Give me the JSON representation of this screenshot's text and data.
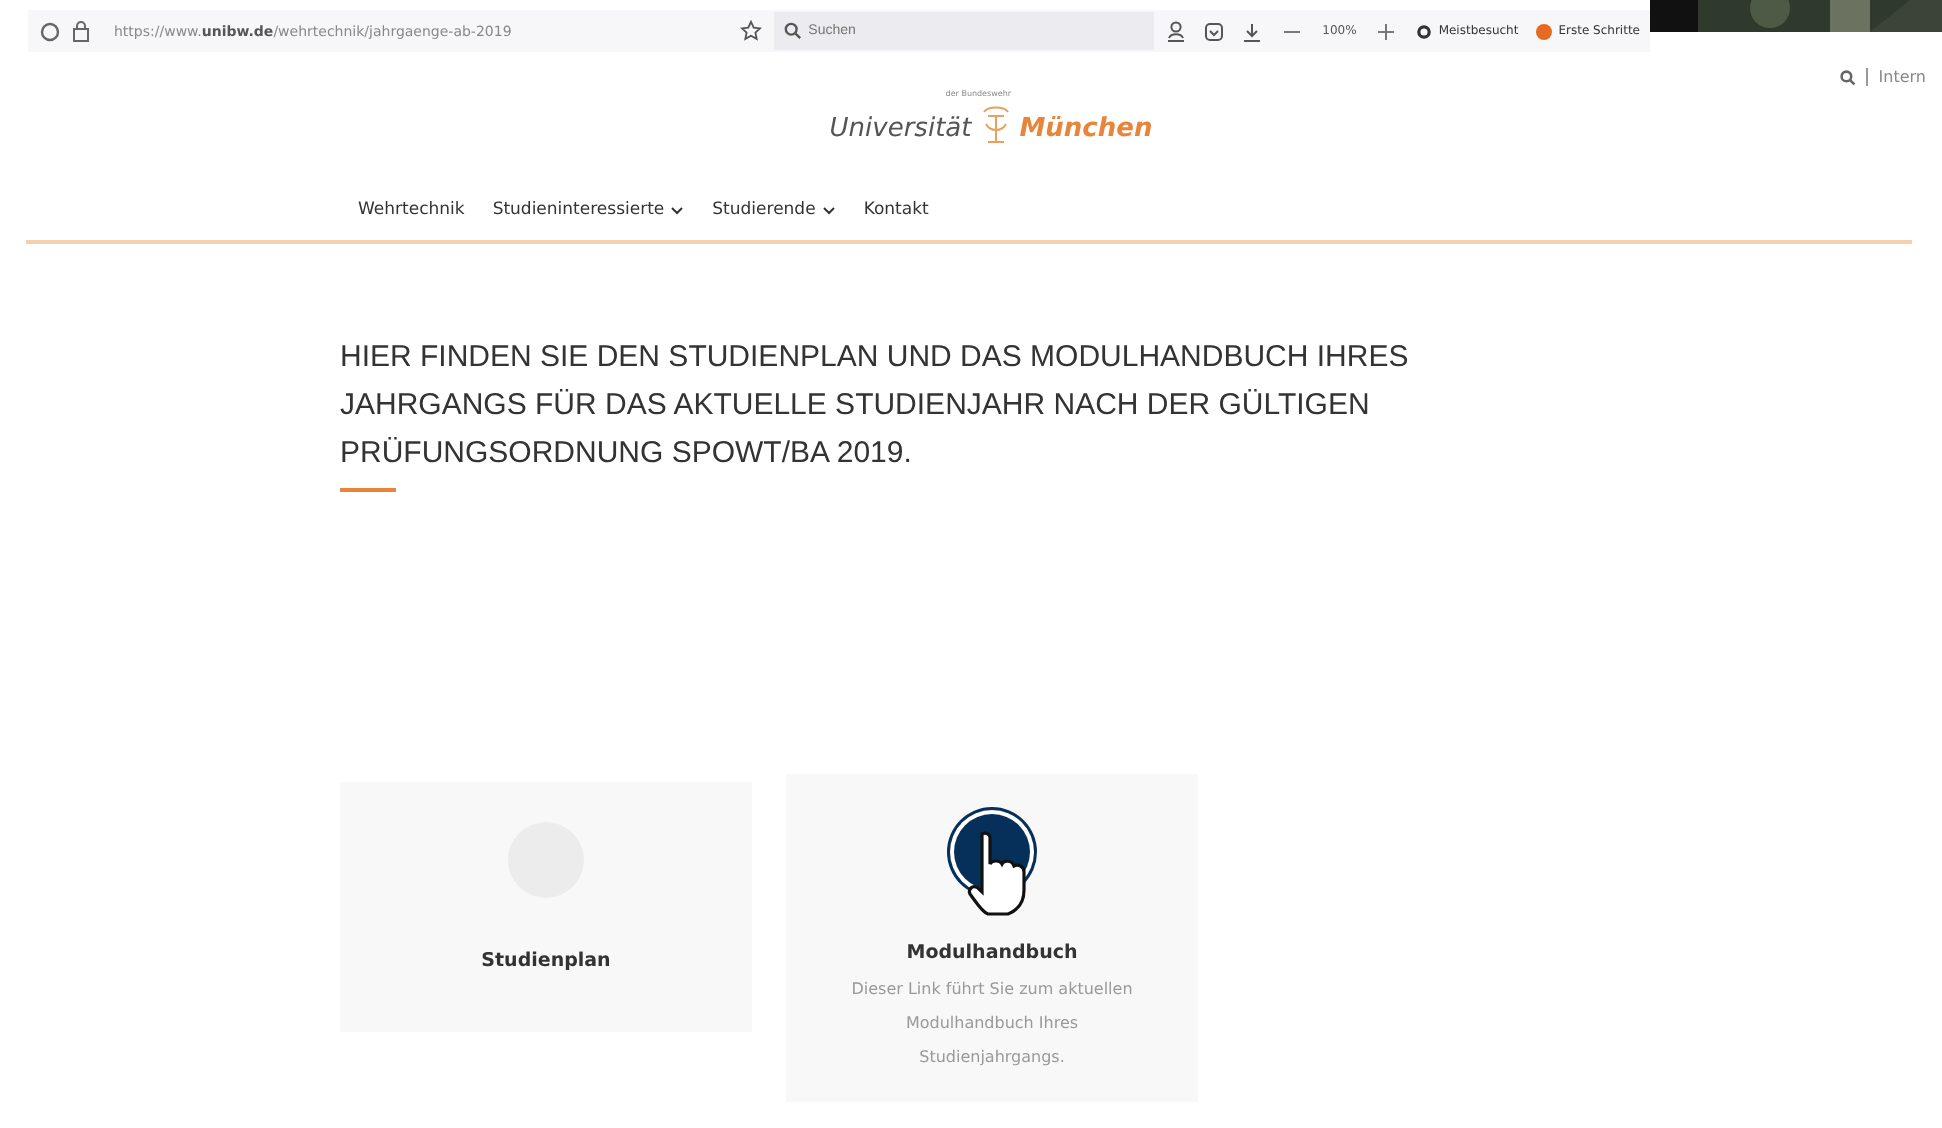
{
  "browser": {
    "url_prefix": "https://www.",
    "url_domain": "unibw.de",
    "url_path": "/wehrtechnik/jahrgaenge-ab-2019",
    "search_placeholder": "Suchen",
    "zoom": "100%",
    "bookmarks": [
      "Meistbesucht",
      "Erste Schritte"
    ]
  },
  "site": {
    "logo_small": "der Bundeswehr",
    "logo_left": "Universität",
    "logo_right": "München",
    "search_link": "Intern",
    "nav": [
      {
        "label": "Wehrtechnik",
        "dropdown": false
      },
      {
        "label": "Studieninteressierte",
        "dropdown": true
      },
      {
        "label": "Studierende",
        "dropdown": true
      },
      {
        "label": "Kontakt",
        "dropdown": false
      }
    ]
  },
  "heading": "HIER FINDEN SIE DEN STUDIENPLAN UND DAS MODULHANDBUCH IHRES JAHRGANGS FÜR DAS AKTUELLE STUDIENJAHR NACH DER GÜLTIGEN PRÜFUNGSORDNUNG SPOWT/BA 2019.",
  "cards": [
    {
      "title": "Studienplan",
      "hovered": false
    },
    {
      "title": "Modulhandbuch",
      "hovered": true,
      "description": "Dieser Link führt Sie zum aktuellen Modulhandbuch Ihres Studienjahrgangs."
    }
  ]
}
